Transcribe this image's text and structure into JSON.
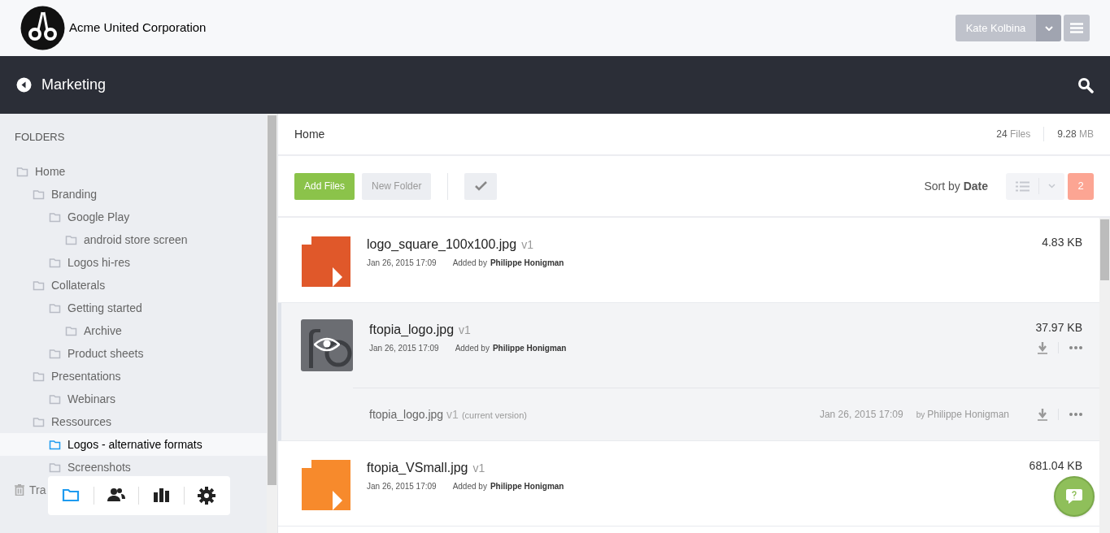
{
  "header": {
    "company": "Acme United Corporation",
    "user": "Kate Kolbina"
  },
  "section": {
    "title": "Marketing"
  },
  "sidebar": {
    "heading": "FOLDERS",
    "tree": [
      {
        "label": "Home",
        "selected": false,
        "children": [
          {
            "label": "Branding",
            "selected": false,
            "children": [
              {
                "label": "Google Play",
                "selected": false,
                "children": [
                  {
                    "label": "android store screen",
                    "selected": false
                  }
                ]
              },
              {
                "label": "Logos hi-res",
                "selected": false
              }
            ]
          },
          {
            "label": "Collaterals",
            "selected": false,
            "children": [
              {
                "label": "Getting started",
                "selected": false,
                "children": [
                  {
                    "label": "Archive",
                    "selected": false
                  }
                ]
              },
              {
                "label": "Product sheets",
                "selected": false
              }
            ]
          },
          {
            "label": "Presentations",
            "selected": false,
            "children": [
              {
                "label": "Webinars",
                "selected": false
              }
            ]
          },
          {
            "label": "Ressources",
            "selected": false,
            "children": [
              {
                "label": "Logos - alternative formats",
                "selected": true
              },
              {
                "label": "Screenshots",
                "selected": false
              }
            ]
          }
        ]
      }
    ],
    "trash": "Tra",
    "dock": [
      {
        "kind": "folder",
        "selected": true
      },
      {
        "kind": "people",
        "selected": false
      },
      {
        "kind": "chart",
        "selected": false
      },
      {
        "kind": "gear",
        "selected": false
      }
    ]
  },
  "breadcrumb": "Home",
  "stats": {
    "files": "24",
    "files_label": "Files",
    "size": "9.28",
    "size_unit": "MB"
  },
  "toolbar": {
    "add": "Add Files",
    "new_folder": "New Folder",
    "sort": "Sort by **Date**",
    "badge": "2"
  },
  "files": [
    {
      "name": "logo_square_100x100.jpg",
      "version": "v1",
      "date": "Jan 26, 2015 17:09",
      "added_by": "Added by",
      "author": "Philippe Honigman",
      "size": "4.83 KB",
      "kind": "doc",
      "color": "#e0582a",
      "selected": false
    },
    {
      "name": "ftopia_logo.jpg",
      "version": "v1",
      "date": "Jan 26, 2015 17:09",
      "added_by": "Added by",
      "author": "Philippe Honigman",
      "size": "37.97 KB",
      "kind": "picture",
      "selected": true,
      "versions": [
        {
          "name": "ftopia_logo.jpg",
          "version": "v1",
          "note": "(current version)",
          "date": "Jan 26, 2015 17:09",
          "by": "by",
          "author": "Philippe Honigman"
        }
      ]
    },
    {
      "name": "ftopia_VSmall.jpg",
      "version": "v1",
      "date": "Jan 26, 2015 17:09",
      "added_by": "Added by",
      "author": "Philippe Honigman",
      "size": "681.04 KB",
      "kind": "doc",
      "color": "#f78a2c",
      "selected": false
    }
  ]
}
